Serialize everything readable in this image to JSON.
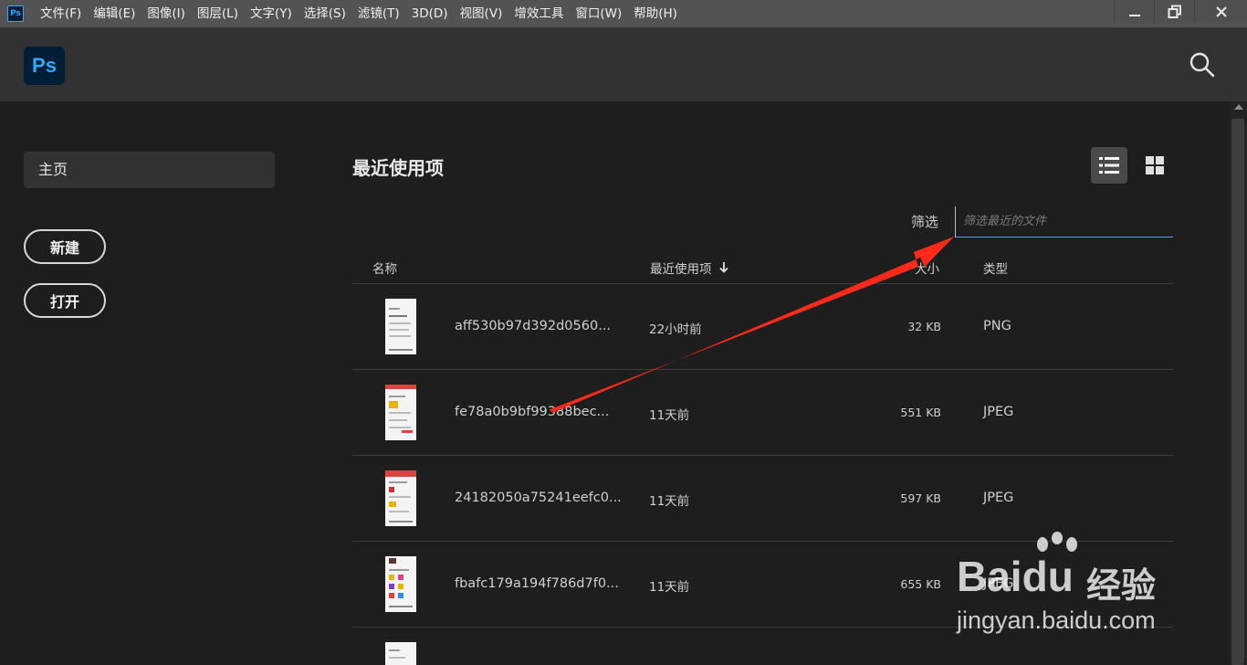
{
  "menubar": {
    "app_icon": "Ps",
    "items": [
      "文件(F)",
      "编辑(E)",
      "图像(I)",
      "图层(L)",
      "文字(Y)",
      "选择(S)",
      "滤镜(T)",
      "3D(D)",
      "视图(V)",
      "增效工具",
      "窗口(W)",
      "帮助(H)"
    ],
    "controls": [
      "minimize-icon",
      "restore-icon",
      "close-icon"
    ]
  },
  "header": {
    "logo": "Ps",
    "search_icon": "search-icon"
  },
  "sidebar": {
    "home": "主页",
    "new_button": "新建",
    "open_button": "打开"
  },
  "main": {
    "title": "最近使用项",
    "filter_label": "筛选",
    "filter_placeholder": "筛选最近的文件",
    "filter_value": "",
    "columns": {
      "name": "名称",
      "recent": "最近使用项",
      "size": "大小",
      "type": "类型"
    },
    "rows": [
      {
        "name": "aff530b97d392d0560...",
        "recent": "22小时前",
        "size": "32 KB",
        "type": "PNG"
      },
      {
        "name": "fe78a0b9bf99388bec...",
        "recent": "11天前",
        "size": "551 KB",
        "type": "JPEG"
      },
      {
        "name": "24182050a75241eefc0...",
        "recent": "11天前",
        "size": "597 KB",
        "type": "JPEG"
      },
      {
        "name": "fbafc179a194f786d7f0...",
        "recent": "11天前",
        "size": "655 KB",
        "type": "JPEG"
      }
    ]
  },
  "watermark": {
    "brand": "Bai",
    "brand_tail": "du",
    "cn": "经验",
    "url": "jingyan.baidu.com"
  },
  "colors": {
    "accent": "#31a8ff",
    "arrow": "#ff2a1a",
    "background": "#1e1e1e"
  }
}
